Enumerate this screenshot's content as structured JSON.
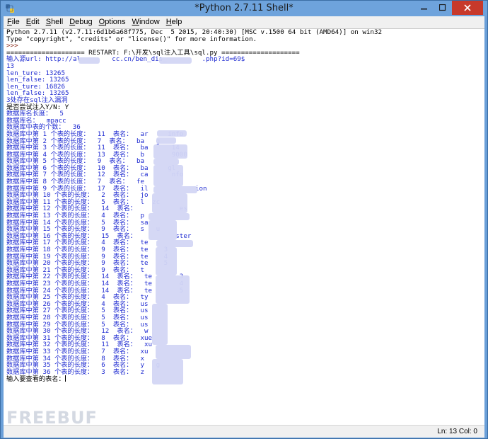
{
  "window": {
    "title": "*Python 2.7.11 Shell*",
    "controls": {
      "minimize": "minimize-icon",
      "maximize": "maximize-icon",
      "close": "close-icon"
    },
    "colors": {
      "titlebar": "#6ea3dc",
      "close": "#c7392b",
      "blue_text": "#1f2bd1",
      "prompt": "#8b2b1c"
    }
  },
  "menu": [
    "File",
    "Edit",
    "Shell",
    "Debug",
    "Options",
    "Window",
    "Help"
  ],
  "menu_underline": [
    "F",
    "E",
    "S",
    "D",
    "O",
    "W",
    "H"
  ],
  "console": {
    "lines": [
      {
        "text": "Python 2.7.11 (v2.7.11:6d1b6a68f775, Dec  5 2015, 20:40:30) [MSC v.1500 64 bit (AMD64)] on win32",
        "color": "black"
      },
      {
        "text": "Type \"copyright\", \"credits\" or \"license()\" for more information.",
        "color": "black"
      },
      {
        "text": ">>> ",
        "color": "prompt"
      },
      {
        "text": "==================== RESTART: F:\\开发\\sql注入工具\\sql.py ====================",
        "color": "black"
      },
      {
        "text": "输入源url: http://al        cc.cn/ben_dis_         .php?id=69$",
        "color": "blue"
      },
      {
        "text": "13",
        "color": "blue"
      },
      {
        "text": "len_ture: 13265",
        "color": "blue"
      },
      {
        "text": "len_false: 13265",
        "color": "blue"
      },
      {
        "text": "len_ture: 16826",
        "color": "blue"
      },
      {
        "text": "len_false: 13265",
        "color": "blue"
      },
      {
        "text": "3处存在sql注入漏洞",
        "color": "blue"
      },
      {
        "text": "是否尝试注入Y/N: Y",
        "color": "black"
      },
      {
        "text": "数据库名长度：  5",
        "color": "blue"
      },
      {
        "text": "数据库名：  mpacc",
        "color": "blue"
      },
      {
        "text": "数据库中表的个数：  36",
        "color": "blue"
      },
      {
        "text": "数据库中第 1 个表的长度：  11  表名：  ar     info",
        "color": "blue"
      },
      {
        "text": "数据库中第 2 个表的长度：  7  表名：  ba   g",
        "color": "blue"
      },
      {
        "text": "数据库中第 3 个表的长度：  11  表名：  ba      14",
        "color": "blue"
      },
      {
        "text": "数据库中第 4 个表的长度：  13  表名：  b       9000",
        "color": "blue"
      },
      {
        "text": "数据库中第 5 个表的长度：  9  表名：  ba",
        "color": "blue"
      },
      {
        "text": "数据库中第 6 个表的长度：  10  表名：  ba     gl",
        "color": "blue"
      },
      {
        "text": "数据库中第 7 个表的长度：  12  表名：  ca      nfo",
        "color": "blue"
      },
      {
        "text": "数据库中第 8 个表的长度：  7  表名：  fe",
        "color": "blue"
      },
      {
        "text": "数据库中第 9 个表的长度：  17  表名：  il            ion",
        "color": "blue"
      },
      {
        "text": "数据库中第 10 个表的长度：  2  表名：  jo",
        "color": "blue"
      },
      {
        "text": "数据库中第 11 个表的长度：  5  表名：  l  zc",
        "color": "blue"
      },
      {
        "text": "数据库中第 12 个表的长度：  14  表名：           es",
        "color": "blue"
      },
      {
        "text": "数据库中第 13 个表的长度：  4  表名：  p",
        "color": "blue"
      },
      {
        "text": "数据库中第 14 个表的长度：  5  表名：  sa",
        "color": "blue"
      },
      {
        "text": "数据库中第 15 个表的长度：  9  表名：  s   u",
        "color": "blue"
      },
      {
        "text": "数据库中第 16 个表的长度：  15  表名：          ster",
        "color": "blue"
      },
      {
        "text": "数据库中第 17 个表的长度：  4  表名：  te",
        "color": "blue"
      },
      {
        "text": "数据库中第 18 个表的长度：  9  表名：  te    3",
        "color": "blue"
      },
      {
        "text": "数据库中第 19 个表的长度：  9  表名：  te    4",
        "color": "blue"
      },
      {
        "text": "数据库中第 20 个表的长度：  9  表名：  te    5",
        "color": "blue"
      },
      {
        "text": "数据库中第 21 个表的长度：  9  表名：  t",
        "color": "blue"
      },
      {
        "text": "数据库中第 22 个表的长度：  14  表名：  te       3",
        "color": "blue"
      },
      {
        "text": "数据库中第 23 个表的长度：  14  表名：  te       4",
        "color": "blue"
      },
      {
        "text": "数据库中第 24 个表的长度：  14  表名：  te       5",
        "color": "blue"
      },
      {
        "text": "数据库中第 25 个表的长度：  4  表名：  ty",
        "color": "blue"
      },
      {
        "text": "数据库中第 26 个表的长度：  4  表名：  us",
        "color": "blue"
      },
      {
        "text": "数据库中第 27 个表的长度：  5  表名：  us",
        "color": "blue"
      },
      {
        "text": "数据库中第 28 个表的长度：  5  表名：  us",
        "color": "blue"
      },
      {
        "text": "数据库中第 29 个表的长度：  5  表名：  us",
        "color": "blue"
      },
      {
        "text": "数据库中第 30 个表的长度：  12  表名：  w",
        "color": "blue"
      },
      {
        "text": "数据库中第 31 个表的长度：  8  表名：  xue",
        "color": "blue"
      },
      {
        "text": "数据库中第 32 个表的长度：  11  表名：  xu",
        "color": "blue"
      },
      {
        "text": "数据库中第 33 个表的长度：  7  表名：  xu",
        "color": "blue"
      },
      {
        "text": "数据库中第 34 个表的长度：  8  表名：  x",
        "color": "blue"
      },
      {
        "text": "数据库中第 35 个表的长度：  6  表名：  y   g",
        "color": "blue"
      },
      {
        "text": "数据库中第 36 个表的长度：  3  表名：  z",
        "color": "blue"
      },
      {
        "text": "输入要查看的表名：",
        "color": "black"
      }
    ]
  },
  "watermark": "FREEBUF",
  "status": {
    "position": "Ln: 13  Col: 0"
  }
}
